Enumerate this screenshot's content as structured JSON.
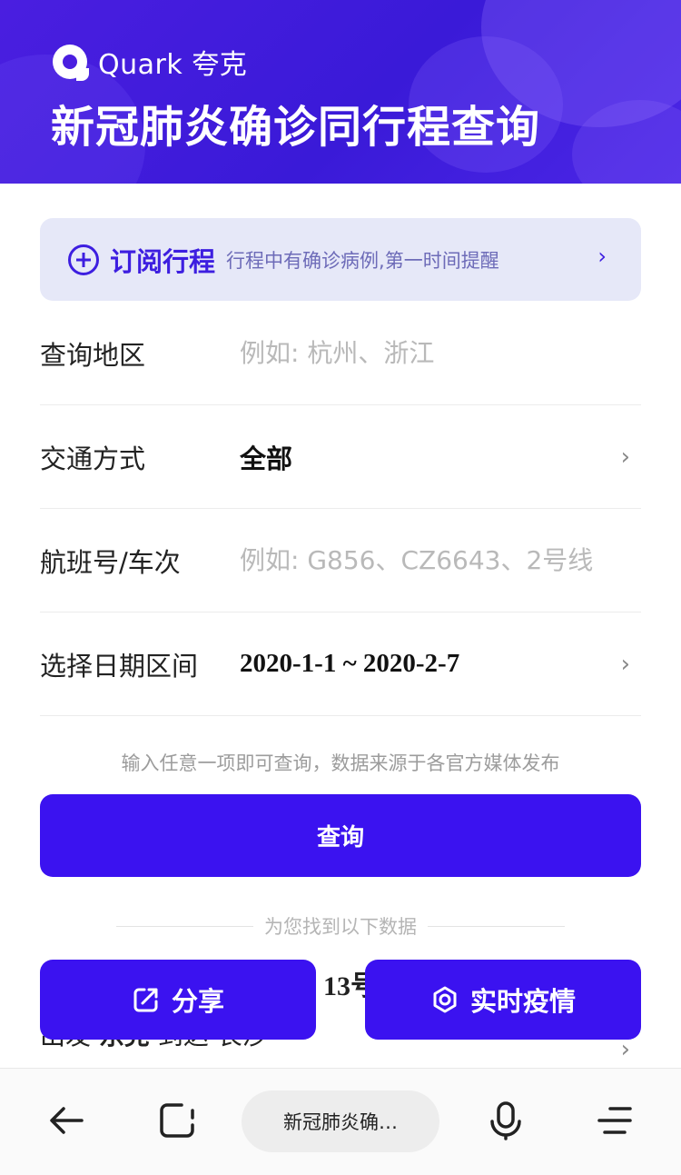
{
  "banner": {
    "logo_text": "Quark 夸克",
    "title": "新冠肺炎确诊同行程查询"
  },
  "subscribe": {
    "title": "订阅行程",
    "description": "行程中有确诊病例,第一时间提醒",
    "chevron": "›"
  },
  "form": {
    "region": {
      "label": "查询地区",
      "placeholder": "例如: 杭州、浙江",
      "value": ""
    },
    "transport": {
      "label": "交通方式",
      "value": "全部"
    },
    "flight": {
      "label": "航班号/车次",
      "placeholder": "例如: G856、CZ6643、2号线",
      "value": ""
    },
    "date_range": {
      "label": "选择日期区间",
      "value": "2020-1-1 ~ 2020-2-7"
    }
  },
  "hint": "输入任意一项即可查询，数据来源于各官方媒体发布",
  "query_button": "查询",
  "results_divider": "为您找到以下数据",
  "result_peek": {
    "line1_fragment": "13号",
    "line2_from_label": "出发",
    "line2_from": "东莞",
    "line2_to_label": "到达",
    "line2_to": "长沙"
  },
  "actions": {
    "share": "分享",
    "live": "实时疫情"
  },
  "browser": {
    "url_text": "新冠肺炎确…"
  },
  "colors": {
    "brand": "#3b12f0",
    "banner": "#4a1ee0",
    "subscribe_bg": "#e6e8f8"
  }
}
